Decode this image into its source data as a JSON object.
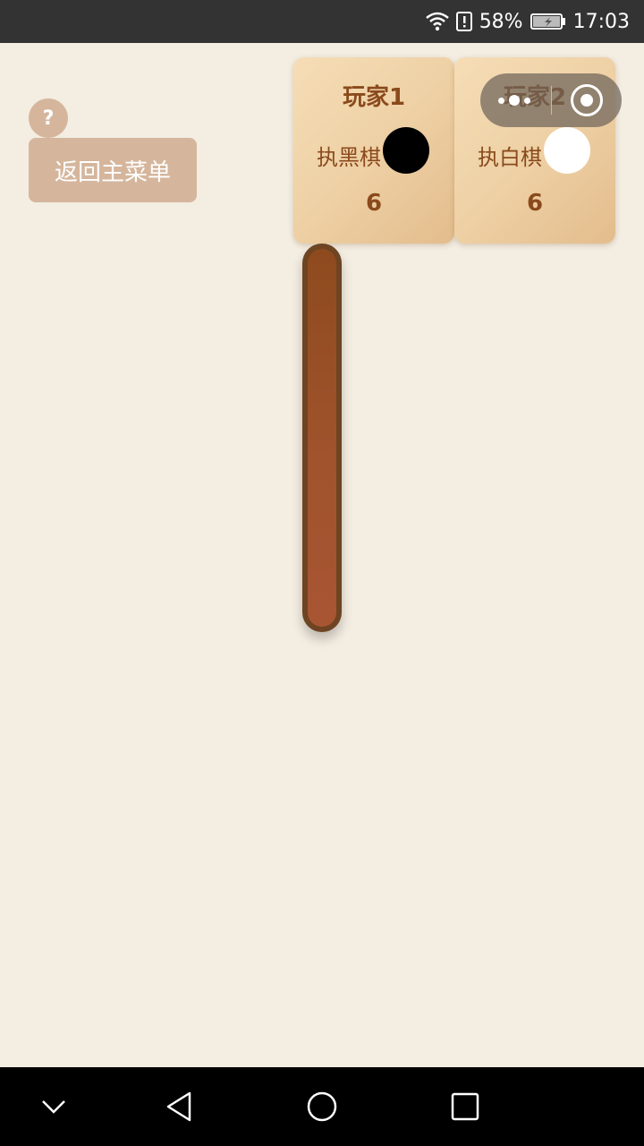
{
  "status_bar": {
    "battery_percent": "58%",
    "time": "17:03",
    "icons": [
      "wifi-icon",
      "battery-alert-icon",
      "battery-icon"
    ]
  },
  "help_label": "?",
  "menu_button_label": "返回主菜单",
  "players": [
    {
      "name": "玩家1",
      "color_label": "执黑棋",
      "stone": "black",
      "score": "6"
    },
    {
      "name": "玩家2",
      "color_label": "执白棋",
      "stone": "white",
      "score": "6"
    }
  ],
  "capsule": {
    "icons": [
      "more-icon",
      "close-target-icon"
    ]
  },
  "nav_bar": {
    "icons": [
      "chevron-down-icon",
      "back-icon",
      "home-icon",
      "recents-icon"
    ]
  },
  "colors": {
    "background": "#f3ede2",
    "accent_text": "#8a4a1c",
    "button": "#d5b69c",
    "board_border": "#6e4422",
    "board_fill": "#a0532c"
  }
}
